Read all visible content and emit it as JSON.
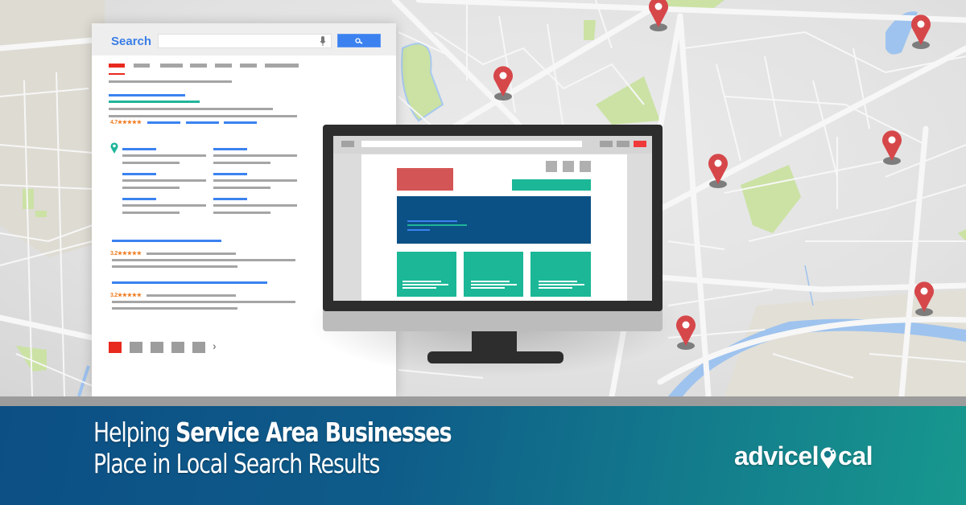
{
  "serp": {
    "search_label": "Search",
    "search_placeholder": "",
    "icons": {
      "mic": "microphone-icon",
      "search": "magnifier-icon",
      "pin": "map-pin-icon",
      "next": "chevron-right-icon"
    },
    "result_ratings": [
      "4.7★★★★★",
      "3.2★★★★★",
      "3.2★★★★★"
    ],
    "pagination_next": "›",
    "pagination_pages": 5,
    "pagination_current": 1
  },
  "banner": {
    "headline_regular_1": "Helping ",
    "headline_bold": "Service Area Businesses",
    "headline_line_2": "Place in Local Search Results",
    "logo_part_1": "advicel",
    "logo_part_2": "cal"
  },
  "map": {
    "pin_count": 8
  },
  "colors": {
    "banner_start": "#0c4f85",
    "banner_end": "#17988e",
    "link_blue": "#3b82f0",
    "teal": "#1fb59a",
    "pin_red": "#d6474a",
    "rating_orange": "#ee7d22",
    "mock_hero": "#0b5185",
    "mock_logo_block": "#d45555",
    "close_red": "#f03a3a"
  }
}
